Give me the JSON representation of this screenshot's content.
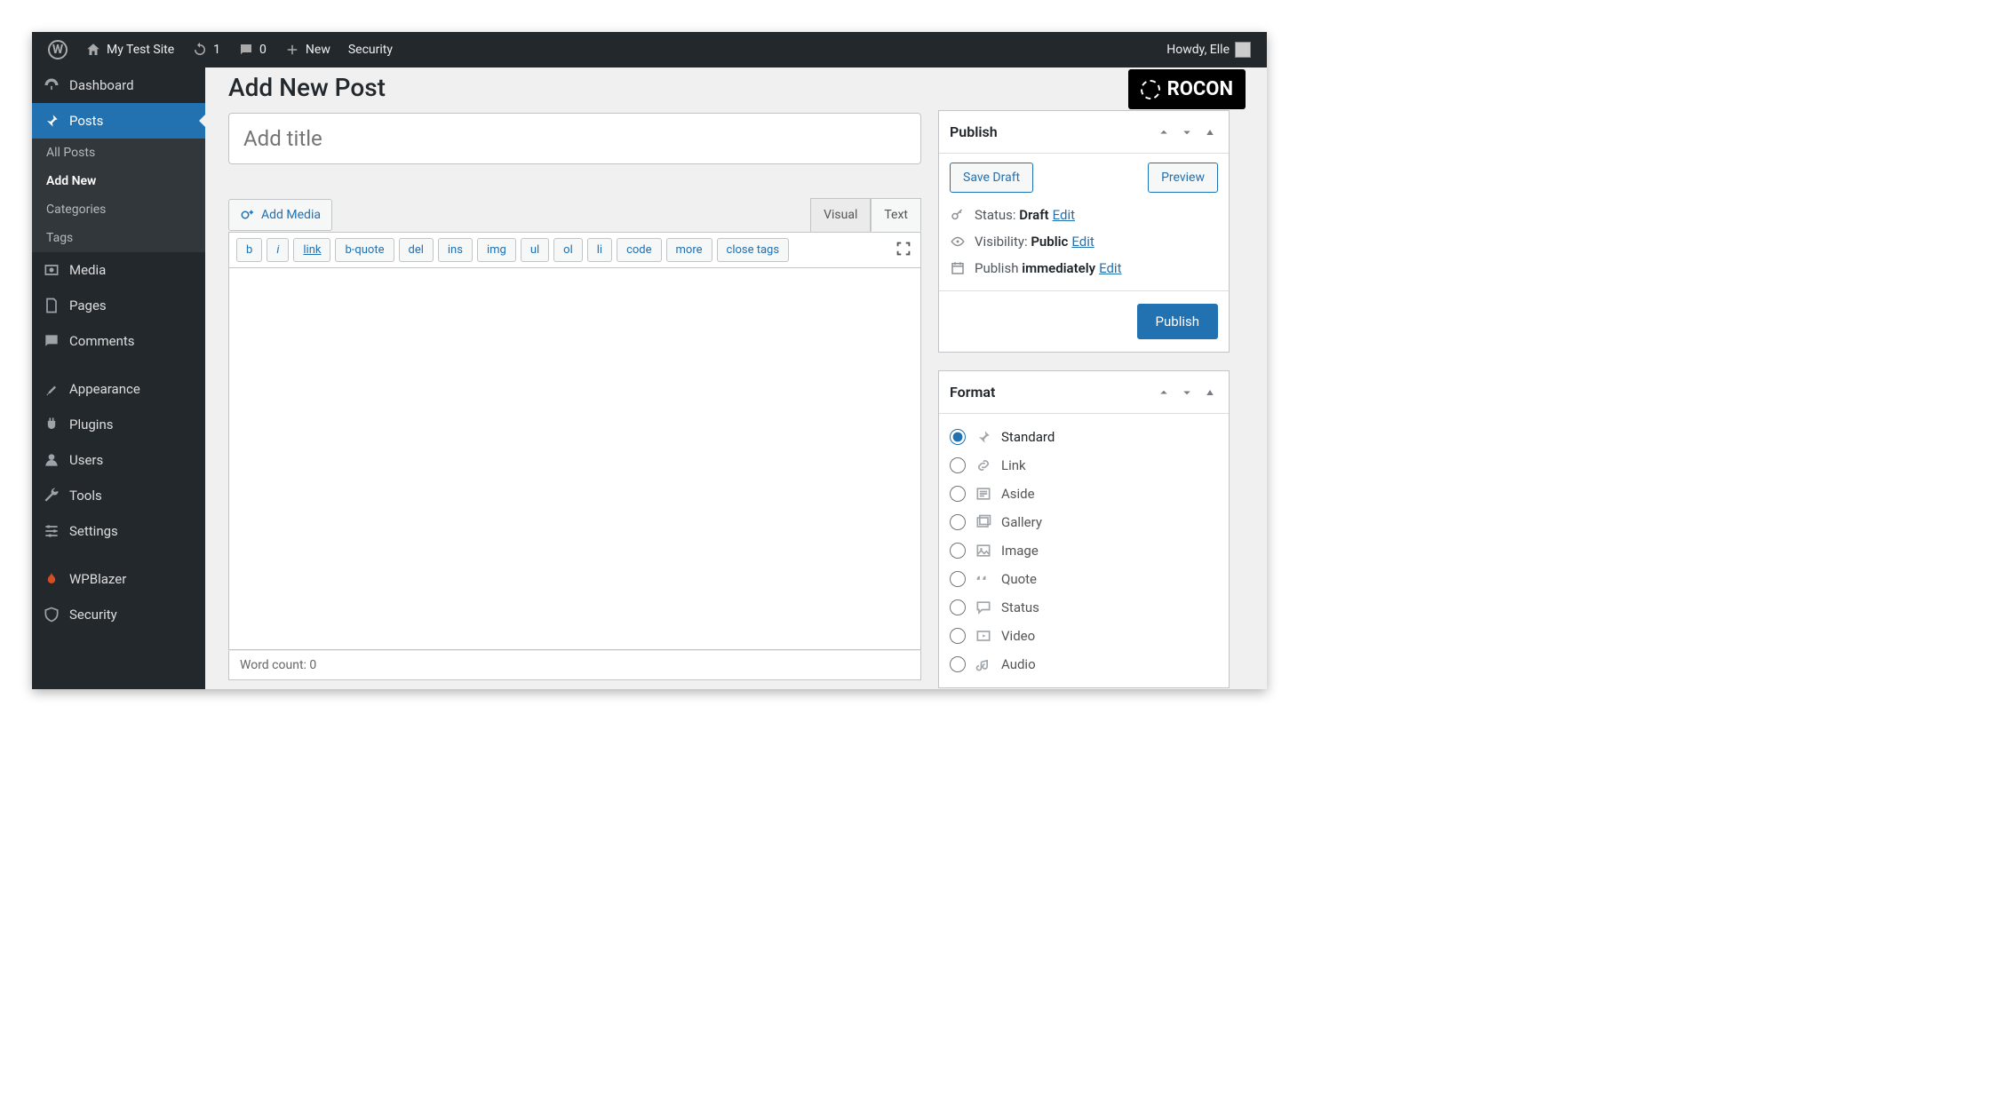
{
  "adminbar": {
    "site_name": "My Test Site",
    "updates_count": "1",
    "comments_count": "0",
    "new_label": "New",
    "security_label": "Security",
    "greeting": "Howdy, Elle"
  },
  "sidebar": {
    "dashboard": "Dashboard",
    "posts": "Posts",
    "submenu": {
      "all_posts": "All Posts",
      "add_new": "Add New",
      "categories": "Categories",
      "tags": "Tags"
    },
    "media": "Media",
    "pages": "Pages",
    "comments": "Comments",
    "appearance": "Appearance",
    "plugins": "Plugins",
    "users": "Users",
    "tools": "Tools",
    "settings": "Settings",
    "wpblazer": "WPBlazer",
    "security": "Security"
  },
  "editor": {
    "page_title": "Add New Post",
    "title_placeholder": "Add title",
    "add_media": "Add Media",
    "tabs": {
      "visual": "Visual",
      "text": "Text"
    },
    "quicktags": [
      "b",
      "i",
      "link",
      "b-quote",
      "del",
      "ins",
      "img",
      "ul",
      "ol",
      "li",
      "code",
      "more",
      "close tags"
    ],
    "word_count_label": "Word count: ",
    "word_count": "0"
  },
  "publish_box": {
    "title": "Publish",
    "save_draft": "Save Draft",
    "preview": "Preview",
    "status_label": "Status: ",
    "status_value": "Draft",
    "visibility_label": "Visibility: ",
    "visibility_value": "Public",
    "schedule_label": "Publish ",
    "schedule_value": "immediately",
    "edit": "Edit",
    "publish_button": "Publish"
  },
  "format_box": {
    "title": "Format",
    "options": [
      "Standard",
      "Link",
      "Aside",
      "Gallery",
      "Image",
      "Quote",
      "Status",
      "Video",
      "Audio"
    ],
    "selected": "Standard"
  },
  "badge": {
    "text": "ROCON"
  }
}
